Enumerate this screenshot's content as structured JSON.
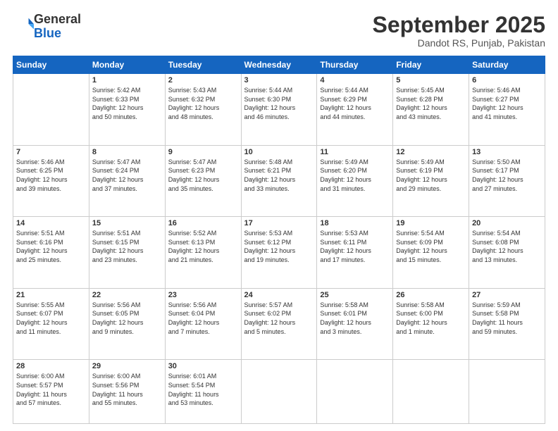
{
  "header": {
    "logo_line1": "General",
    "logo_line2": "Blue",
    "month": "September 2025",
    "location": "Dandot RS, Punjab, Pakistan"
  },
  "weekdays": [
    "Sunday",
    "Monday",
    "Tuesday",
    "Wednesday",
    "Thursday",
    "Friday",
    "Saturday"
  ],
  "weeks": [
    [
      {
        "day": "",
        "info": ""
      },
      {
        "day": "1",
        "info": "Sunrise: 5:42 AM\nSunset: 6:33 PM\nDaylight: 12 hours\nand 50 minutes."
      },
      {
        "day": "2",
        "info": "Sunrise: 5:43 AM\nSunset: 6:32 PM\nDaylight: 12 hours\nand 48 minutes."
      },
      {
        "day": "3",
        "info": "Sunrise: 5:44 AM\nSunset: 6:30 PM\nDaylight: 12 hours\nand 46 minutes."
      },
      {
        "day": "4",
        "info": "Sunrise: 5:44 AM\nSunset: 6:29 PM\nDaylight: 12 hours\nand 44 minutes."
      },
      {
        "day": "5",
        "info": "Sunrise: 5:45 AM\nSunset: 6:28 PM\nDaylight: 12 hours\nand 43 minutes."
      },
      {
        "day": "6",
        "info": "Sunrise: 5:46 AM\nSunset: 6:27 PM\nDaylight: 12 hours\nand 41 minutes."
      }
    ],
    [
      {
        "day": "7",
        "info": "Sunrise: 5:46 AM\nSunset: 6:25 PM\nDaylight: 12 hours\nand 39 minutes."
      },
      {
        "day": "8",
        "info": "Sunrise: 5:47 AM\nSunset: 6:24 PM\nDaylight: 12 hours\nand 37 minutes."
      },
      {
        "day": "9",
        "info": "Sunrise: 5:47 AM\nSunset: 6:23 PM\nDaylight: 12 hours\nand 35 minutes."
      },
      {
        "day": "10",
        "info": "Sunrise: 5:48 AM\nSunset: 6:21 PM\nDaylight: 12 hours\nand 33 minutes."
      },
      {
        "day": "11",
        "info": "Sunrise: 5:49 AM\nSunset: 6:20 PM\nDaylight: 12 hours\nand 31 minutes."
      },
      {
        "day": "12",
        "info": "Sunrise: 5:49 AM\nSunset: 6:19 PM\nDaylight: 12 hours\nand 29 minutes."
      },
      {
        "day": "13",
        "info": "Sunrise: 5:50 AM\nSunset: 6:17 PM\nDaylight: 12 hours\nand 27 minutes."
      }
    ],
    [
      {
        "day": "14",
        "info": "Sunrise: 5:51 AM\nSunset: 6:16 PM\nDaylight: 12 hours\nand 25 minutes."
      },
      {
        "day": "15",
        "info": "Sunrise: 5:51 AM\nSunset: 6:15 PM\nDaylight: 12 hours\nand 23 minutes."
      },
      {
        "day": "16",
        "info": "Sunrise: 5:52 AM\nSunset: 6:13 PM\nDaylight: 12 hours\nand 21 minutes."
      },
      {
        "day": "17",
        "info": "Sunrise: 5:53 AM\nSunset: 6:12 PM\nDaylight: 12 hours\nand 19 minutes."
      },
      {
        "day": "18",
        "info": "Sunrise: 5:53 AM\nSunset: 6:11 PM\nDaylight: 12 hours\nand 17 minutes."
      },
      {
        "day": "19",
        "info": "Sunrise: 5:54 AM\nSunset: 6:09 PM\nDaylight: 12 hours\nand 15 minutes."
      },
      {
        "day": "20",
        "info": "Sunrise: 5:54 AM\nSunset: 6:08 PM\nDaylight: 12 hours\nand 13 minutes."
      }
    ],
    [
      {
        "day": "21",
        "info": "Sunrise: 5:55 AM\nSunset: 6:07 PM\nDaylight: 12 hours\nand 11 minutes."
      },
      {
        "day": "22",
        "info": "Sunrise: 5:56 AM\nSunset: 6:05 PM\nDaylight: 12 hours\nand 9 minutes."
      },
      {
        "day": "23",
        "info": "Sunrise: 5:56 AM\nSunset: 6:04 PM\nDaylight: 12 hours\nand 7 minutes."
      },
      {
        "day": "24",
        "info": "Sunrise: 5:57 AM\nSunset: 6:02 PM\nDaylight: 12 hours\nand 5 minutes."
      },
      {
        "day": "25",
        "info": "Sunrise: 5:58 AM\nSunset: 6:01 PM\nDaylight: 12 hours\nand 3 minutes."
      },
      {
        "day": "26",
        "info": "Sunrise: 5:58 AM\nSunset: 6:00 PM\nDaylight: 12 hours\nand 1 minute."
      },
      {
        "day": "27",
        "info": "Sunrise: 5:59 AM\nSunset: 5:58 PM\nDaylight: 11 hours\nand 59 minutes."
      }
    ],
    [
      {
        "day": "28",
        "info": "Sunrise: 6:00 AM\nSunset: 5:57 PM\nDaylight: 11 hours\nand 57 minutes."
      },
      {
        "day": "29",
        "info": "Sunrise: 6:00 AM\nSunset: 5:56 PM\nDaylight: 11 hours\nand 55 minutes."
      },
      {
        "day": "30",
        "info": "Sunrise: 6:01 AM\nSunset: 5:54 PM\nDaylight: 11 hours\nand 53 minutes."
      },
      {
        "day": "",
        "info": ""
      },
      {
        "day": "",
        "info": ""
      },
      {
        "day": "",
        "info": ""
      },
      {
        "day": "",
        "info": ""
      }
    ]
  ]
}
